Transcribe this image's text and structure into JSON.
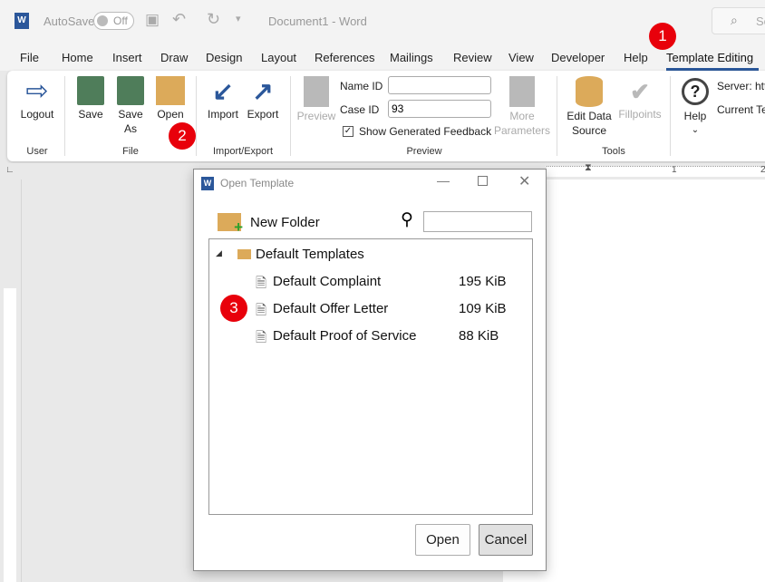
{
  "titlebar": {
    "autosave_label": "AutoSave",
    "autosave_state": "Off",
    "doc_title": "Document1  -  Word",
    "search_placeholder": "Se"
  },
  "menu": {
    "tabs": [
      "File",
      "Home",
      "Insert",
      "Draw",
      "Design",
      "Layout",
      "References",
      "Mailings",
      "Review",
      "View",
      "Developer",
      "Help",
      "Template Editing"
    ],
    "active": "Template Editing"
  },
  "ribbon": {
    "logout": "Logout",
    "save": "Save",
    "save_as": "Save As",
    "open": "Open",
    "import": "Import",
    "export": "Export",
    "preview": "Preview",
    "name_id_label": "Name ID",
    "name_id_value": "",
    "case_id_label": "Case ID",
    "case_id_value": "93",
    "show_feedback_label": "Show Generated Feedback",
    "show_feedback_checked": true,
    "more_parameters": "More Parameters",
    "edit_data_source": "Edit Data Source",
    "fillpoints": "Fillpoints",
    "help": "Help",
    "server_label": "Server: htt",
    "current_label": "Current Te",
    "groups": {
      "user": "User",
      "file": "File",
      "import_export": "Import/Export",
      "preview": "Preview",
      "tools": "Tools"
    }
  },
  "ruler": {
    "marks": [
      "1",
      "2"
    ]
  },
  "annotations": [
    "1",
    "2",
    "3"
  ],
  "dialog": {
    "title": "Open Template",
    "new_folder": "New Folder",
    "search_value": "",
    "folder": "Default Templates",
    "files": [
      {
        "name": "Default Complaint",
        "size": "195 KiB"
      },
      {
        "name": "Default Offer Letter",
        "size": "109 KiB"
      },
      {
        "name": "Default Proof of Service",
        "size": "88 KiB"
      }
    ],
    "open_button": "Open",
    "cancel_button": "Cancel"
  },
  "colors": {
    "accent": "#2b579a",
    "badge": "#e8000b",
    "folder": "#dcaa5a",
    "save_green": "#4f7d5a"
  }
}
